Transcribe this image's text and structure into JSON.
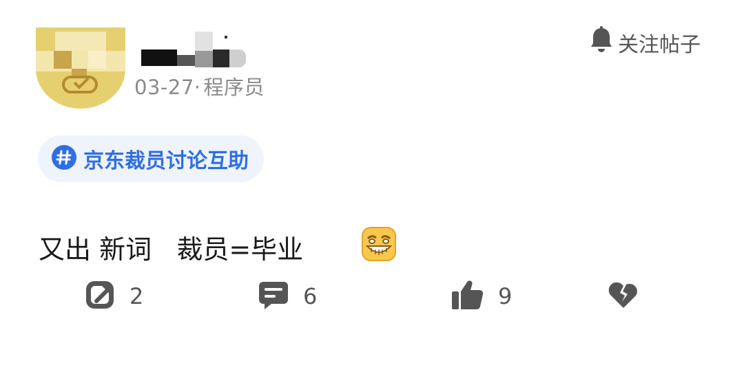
{
  "post": {
    "date": "03-27",
    "separator": "·",
    "category": "程序员",
    "follow_label": "关注帖子",
    "topic": "京东裁员讨论互助",
    "content": "又出 新词   裁员=毕业"
  },
  "actions": {
    "share_count": "2",
    "comment_count": "6",
    "like_count": "9"
  },
  "colors": {
    "topic_text": "#2f6fe2",
    "topic_bg": "#eef3fc",
    "icon_gray": "#555555",
    "meta_gray": "#8a8a8a"
  },
  "icons": [
    "bell-icon",
    "hashtag-icon",
    "grin-emoji-icon",
    "share-icon",
    "comment-icon",
    "thumbs-up-icon",
    "broken-heart-icon"
  ]
}
